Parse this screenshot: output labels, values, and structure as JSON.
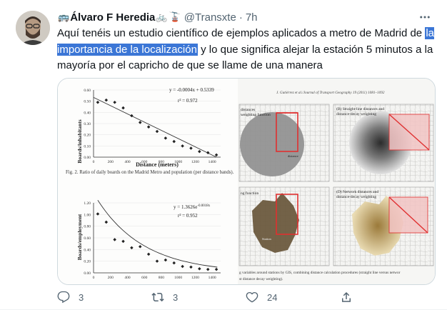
{
  "tweet": {
    "display_name": "Álvaro F Heredia",
    "display_name_emojis": [
      "🚌",
      "🚲",
      "🚡"
    ],
    "handle": "@Transxte",
    "dot": "·",
    "time": "7h",
    "text_before": "Aquí tenéis un estudio científico de ejemplos aplicados a metro de Madrid de ",
    "text_highlight": "la importancia de la localización",
    "text_after": " y lo que significa alejar la estación 5 minutos a la mayoría por el capricho de que se llame de una manera",
    "highlight_color": "#3b76d6"
  },
  "media": {
    "chart_top": {
      "type": "scatter",
      "ylabel": "Boards/inhabitants",
      "xlabel": "Distance (meters)",
      "yticks": [
        "0.60",
        "0.50",
        "0.40",
        "0.30",
        "0.20",
        "0.10",
        "0.00"
      ],
      "xticks": [
        "0",
        "200",
        "400",
        "600",
        "800",
        "1000",
        "1200",
        "1400"
      ],
      "equation": "y = -0.0004x + 0.5339",
      "r2": "r² = 0.972",
      "caption": "Fig. 2. Ratio of daily boards on the Madrid Metro and population (per distance bands)."
    },
    "chart_bottom": {
      "type": "scatter",
      "ylabel": "Boards/employment",
      "yticks": [
        "1.20",
        "1.00",
        "0.80",
        "0.60",
        "0.40",
        "0.20",
        "0.00"
      ],
      "xticks": [
        "0",
        "200",
        "400",
        "600",
        "800",
        "1000",
        "1200",
        "1400"
      ],
      "equation": "y = 1.3626e",
      "equation_exp": "-0.0018x",
      "r2": "r² = 0.952"
    },
    "journal_header": "J. Gutiérrez et al./Journal of Transport Geography 19 (2011) 1081–1092",
    "map_panels": {
      "a_label": "distances",
      "a_sub": "weighting function",
      "b_label": "(B) Straight-line distances and",
      "b_sub": "distance-decay weighting",
      "c_label": "ng function",
      "d_label": "(D) Network distances and",
      "d_sub": "distance-decay weighting",
      "axis_weight": "weight",
      "axis_distance": "distance",
      "axis_station": "Station"
    },
    "footer_text_1": "g variables around stations by GIS, combining distance calculation procedures (straight line versus networ",
    "footer_text_2": "st distance decay weighting)."
  },
  "chart_data": [
    {
      "type": "scatter",
      "title": "",
      "xlabel": "Distance (meters)",
      "ylabel": "Boards/inhabitants",
      "xlim": [
        0,
        1500
      ],
      "ylim": [
        0,
        0.6
      ],
      "x": [
        50,
        150,
        250,
        350,
        450,
        550,
        650,
        750,
        850,
        950,
        1050,
        1150,
        1250,
        1350,
        1450
      ],
      "y": [
        0.49,
        0.51,
        0.49,
        0.44,
        0.37,
        0.31,
        0.27,
        0.23,
        0.17,
        0.14,
        0.1,
        0.08,
        0.05,
        0.04,
        0.02
      ]
    },
    {
      "type": "scatter",
      "title": "",
      "xlabel": "",
      "ylabel": "Boards/employment",
      "xlim": [
        0,
        1500
      ],
      "ylim": [
        0,
        1.2
      ],
      "x": [
        50,
        150,
        250,
        350,
        450,
        550,
        650,
        750,
        850,
        950,
        1050,
        1150,
        1250,
        1350,
        1450
      ],
      "y": [
        1.01,
        0.87,
        0.57,
        0.54,
        0.43,
        0.45,
        0.32,
        0.2,
        0.22,
        0.17,
        0.11,
        0.1,
        0.07,
        0.06,
        0.06
      ]
    }
  ],
  "actions": {
    "reply_count": "3",
    "retweet_count": "3",
    "like_count": "24"
  },
  "colors": {
    "text": "#0f1419",
    "secondary": "#536471",
    "border": "#cfd9de",
    "map_red": "#e03030"
  }
}
